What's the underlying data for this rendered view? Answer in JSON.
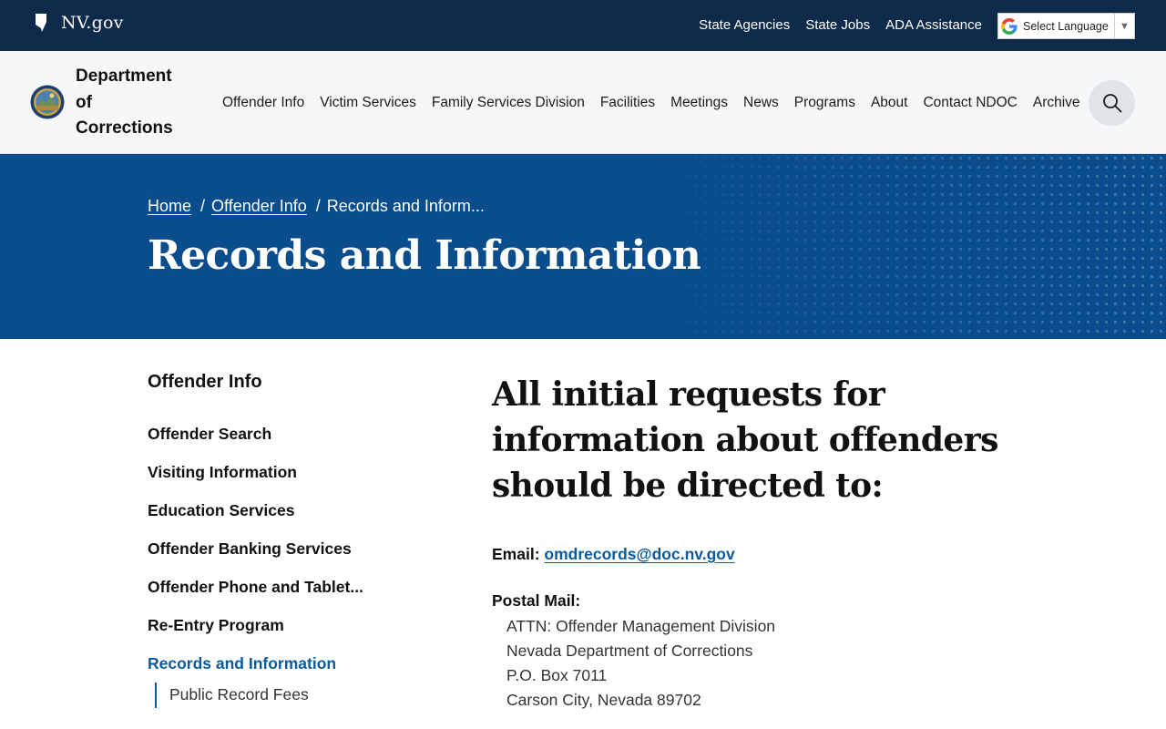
{
  "topbar": {
    "site_name": "NV.gov",
    "links": [
      "State Agencies",
      "State Jobs",
      "ADA Assistance"
    ],
    "language_select": "Select Language"
  },
  "header": {
    "dept_lines": [
      "Department",
      "of",
      "Corrections"
    ],
    "nav": [
      "Offender Info",
      "Victim Services",
      "Family Services Division",
      "Facilities",
      "Meetings",
      "News",
      "Programs",
      "About",
      "Contact NDOC",
      "Archive"
    ]
  },
  "hero": {
    "breadcrumb": {
      "home": "Home",
      "parent": "Offender Info",
      "current": "Records and Inform...",
      "separator": "/"
    },
    "title": "Records and Information"
  },
  "sidebar": {
    "heading": "Offender Info",
    "items": [
      "Offender Search",
      "Visiting Information",
      "Education Services",
      "Offender Banking Services",
      "Offender Phone and Tablet...",
      "Re-Entry Program",
      "Records and Information"
    ],
    "active_index": 6,
    "sub_item": "Public Record Fees"
  },
  "content": {
    "heading": "All initial requests for information about offenders should be directed to:",
    "email_label": "Email:",
    "email_value": "omdrecords@doc.nv.gov",
    "postal_label": "Postal Mail:",
    "address_lines": [
      "ATTN: Offender Management Division",
      "Nevada Department of Corrections",
      "P.O. Box 7011",
      "Carson City, Nevada 89702"
    ]
  },
  "colors": {
    "topbar_bg": "#0e2a4a",
    "hero_bg": "#0a4d8c",
    "link_blue": "#0a5a9c"
  },
  "icons": [
    "nevada-state-icon",
    "google-g-icon",
    "dropdown-arrow-icon",
    "department-seal-icon",
    "search-icon"
  ]
}
